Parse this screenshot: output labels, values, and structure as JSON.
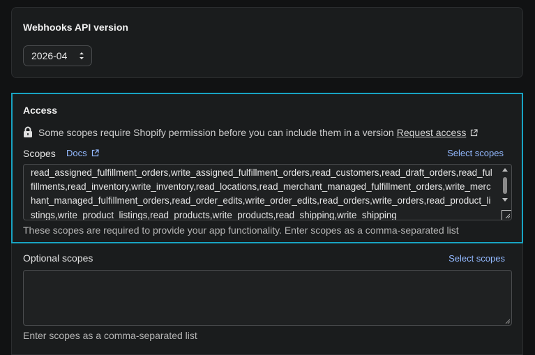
{
  "webhooks": {
    "title": "Webhooks API version",
    "version_value": "2026-04"
  },
  "access": {
    "title": "Access",
    "permission_notice": "Some scopes require Shopify permission before you can include them in a version",
    "request_access_label": "Request access",
    "scopes_label": "Scopes",
    "docs_label": "Docs",
    "select_scopes_label": "Select scopes",
    "scopes_value": "read_assigned_fulfillment_orders,write_assigned_fulfillment_orders,read_customers,read_draft_orders,read_fulfillments,read_inventory,write_inventory,read_locations,read_merchant_managed_fulfillment_orders,write_merchant_managed_fulfillment_orders,read_order_edits,write_order_edits,read_orders,write_orders,read_product_listings,write_product_listings,read_products,write_products,read_shipping,write_shipping",
    "help_text": "These scopes are required to provide your app functionality. Enter scopes as a comma-separated list"
  },
  "optional": {
    "label": "Optional scopes",
    "select_scopes_label": "Select scopes",
    "value": "",
    "help_text": "Enter scopes as a comma-separated list"
  },
  "colors": {
    "focus_border": "#18a3c2",
    "link": "#93b9ff",
    "background": "#111213",
    "card": "#1a1c1d"
  }
}
